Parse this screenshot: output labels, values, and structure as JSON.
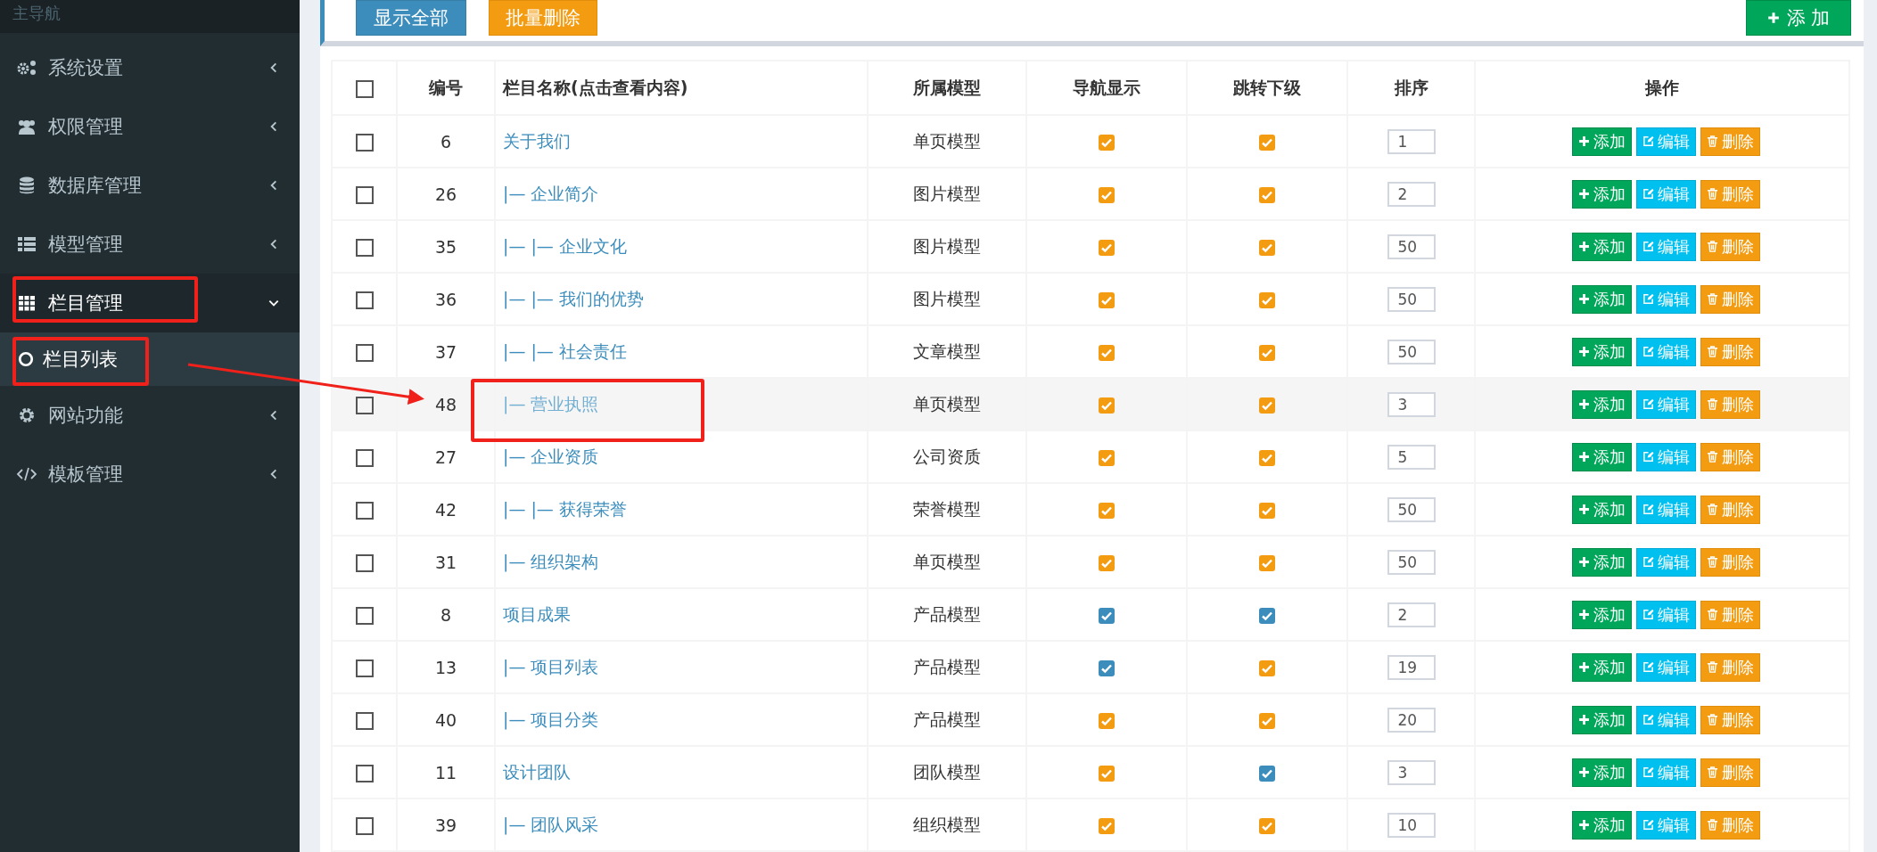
{
  "sidebar": {
    "header": "主导航",
    "items": [
      {
        "label": "系统设置",
        "expanded": false
      },
      {
        "label": "权限管理",
        "expanded": false
      },
      {
        "label": "数据库管理",
        "expanded": false
      },
      {
        "label": "模型管理",
        "expanded": false
      },
      {
        "label": "栏目管理",
        "expanded": true,
        "children": [
          {
            "label": "栏目列表",
            "selected": true
          }
        ]
      },
      {
        "label": "网站功能",
        "expanded": false
      },
      {
        "label": "模板管理",
        "expanded": false
      }
    ]
  },
  "toolbar": {
    "buttons": [
      {
        "label": "显示全部",
        "kind": "primary"
      },
      {
        "label": "批量删除",
        "kind": "warning"
      }
    ],
    "add_button": "添 加"
  },
  "table": {
    "select_all_checked": false,
    "columns": [
      "编号",
      "栏目名称(点击查看内容)",
      "所属模型",
      "导航显示",
      "跳转下级",
      "排序",
      "操作"
    ],
    "rows": [
      {
        "checked": false,
        "hovered": false,
        "id": "6",
        "name": "关于我们",
        "model": "单页模型",
        "nav": {
          "color": "#f39c12"
        },
        "jump": {
          "color": "#f39c12"
        },
        "sort": "1",
        "actions": [
          "添加",
          "编辑",
          "删除"
        ]
      },
      {
        "checked": false,
        "hovered": false,
        "id": "26",
        "name": "|— 企业简介",
        "model": "图片模型",
        "nav": {
          "color": "#f39c12"
        },
        "jump": {
          "color": "#f39c12"
        },
        "sort": "2",
        "actions": [
          "添加",
          "编辑",
          "删除"
        ]
      },
      {
        "checked": false,
        "hovered": false,
        "id": "35",
        "name": "|— |— 企业文化",
        "model": "图片模型",
        "nav": {
          "color": "#f39c12"
        },
        "jump": {
          "color": "#f39c12"
        },
        "sort": "50",
        "actions": [
          "添加",
          "编辑",
          "删除"
        ]
      },
      {
        "checked": false,
        "hovered": false,
        "id": "36",
        "name": "|— |— 我们的优势",
        "model": "图片模型",
        "nav": {
          "color": "#f39c12"
        },
        "jump": {
          "color": "#f39c12"
        },
        "sort": "50",
        "actions": [
          "添加",
          "编辑",
          "删除"
        ]
      },
      {
        "checked": false,
        "hovered": false,
        "id": "37",
        "name": "|— |— 社会责任",
        "model": "文章模型",
        "nav": {
          "color": "#f39c12"
        },
        "jump": {
          "color": "#f39c12"
        },
        "sort": "50",
        "actions": [
          "添加",
          "编辑",
          "删除"
        ]
      },
      {
        "checked": false,
        "hovered": true,
        "id": "48",
        "name": "|— 营业执照",
        "model": "单页模型",
        "nav": {
          "color": "#f39c12"
        },
        "jump": {
          "color": "#f39c12"
        },
        "sort": "3",
        "actions": [
          "添加",
          "编辑",
          "删除"
        ]
      },
      {
        "checked": false,
        "hovered": false,
        "id": "27",
        "name": "|— 企业资质",
        "model": "公司资质",
        "nav": {
          "color": "#f39c12"
        },
        "jump": {
          "color": "#f39c12"
        },
        "sort": "5",
        "actions": [
          "添加",
          "编辑",
          "删除"
        ]
      },
      {
        "checked": false,
        "hovered": false,
        "id": "42",
        "name": "|— |— 获得荣誉",
        "model": "荣誉模型",
        "nav": {
          "color": "#f39c12"
        },
        "jump": {
          "color": "#f39c12"
        },
        "sort": "50",
        "actions": [
          "添加",
          "编辑",
          "删除"
        ]
      },
      {
        "checked": false,
        "hovered": false,
        "id": "31",
        "name": "|— 组织架构",
        "model": "单页模型",
        "nav": {
          "color": "#f39c12"
        },
        "jump": {
          "color": "#f39c12"
        },
        "sort": "50",
        "actions": [
          "添加",
          "编辑",
          "删除"
        ]
      },
      {
        "checked": false,
        "hovered": false,
        "id": "8",
        "name": "项目成果",
        "model": "产品模型",
        "nav": {
          "color": "#3c8dbc"
        },
        "jump": {
          "color": "#3c8dbc"
        },
        "sort": "2",
        "actions": [
          "添加",
          "编辑",
          "删除"
        ]
      },
      {
        "checked": false,
        "hovered": false,
        "id": "13",
        "name": "|— 项目列表",
        "model": "产品模型",
        "nav": {
          "color": "#3c8dbc"
        },
        "jump": {
          "color": "#f39c12"
        },
        "sort": "19",
        "actions": [
          "添加",
          "编辑",
          "删除"
        ]
      },
      {
        "checked": false,
        "hovered": false,
        "id": "40",
        "name": "|— 项目分类",
        "model": "产品模型",
        "nav": {
          "color": "#f39c12"
        },
        "jump": {
          "color": "#f39c12"
        },
        "sort": "20",
        "actions": [
          "添加",
          "编辑",
          "删除"
        ]
      },
      {
        "checked": false,
        "hovered": false,
        "id": "11",
        "name": "设计团队",
        "model": "团队模型",
        "nav": {
          "color": "#f39c12"
        },
        "jump": {
          "color": "#3c8dbc"
        },
        "sort": "3",
        "actions": [
          "添加",
          "编辑",
          "删除"
        ]
      },
      {
        "checked": false,
        "hovered": false,
        "id": "39",
        "name": "|— 团队风采",
        "model": "组织模型",
        "nav": {
          "color": "#f39c12"
        },
        "jump": {
          "color": "#f39c12"
        },
        "sort": "10",
        "actions": [
          "添加",
          "编辑",
          "删除"
        ]
      }
    ]
  }
}
